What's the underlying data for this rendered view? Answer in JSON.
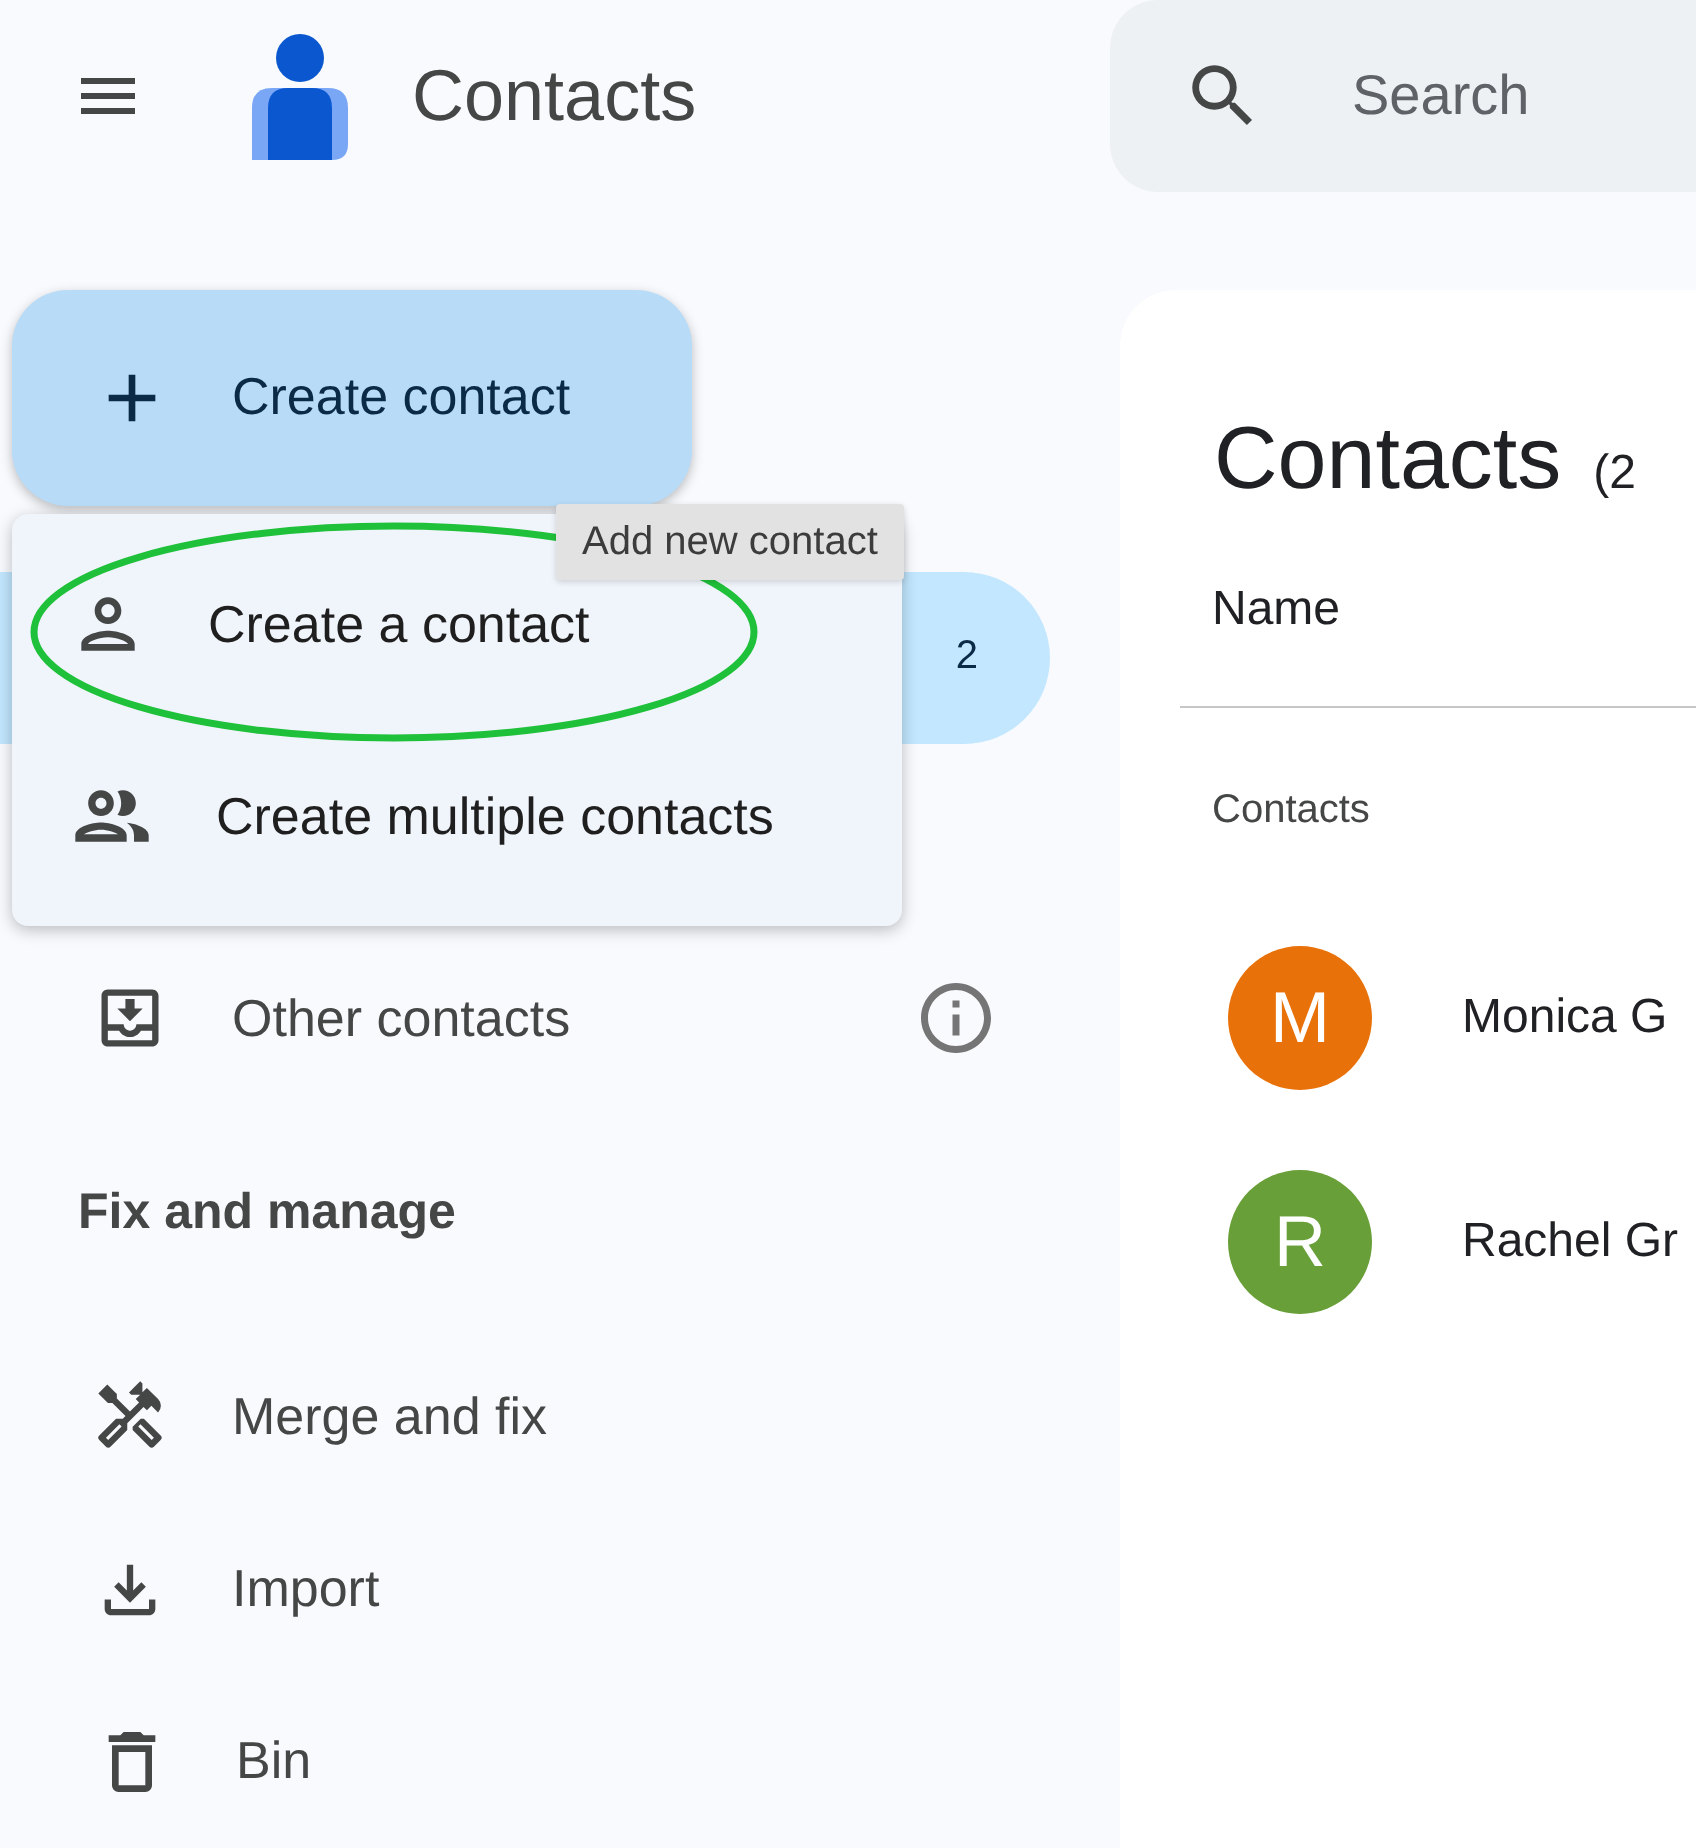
{
  "app": {
    "title": "Contacts"
  },
  "search": {
    "placeholder": "Search"
  },
  "create_button": {
    "label": "Create contact"
  },
  "nav_contacts": {
    "count": "2",
    "selected": true
  },
  "create_menu": {
    "items": [
      {
        "kind": "single",
        "label": "Create a contact",
        "circled": true
      },
      {
        "kind": "multiple",
        "label": "Create multiple contacts",
        "circled": false
      }
    ]
  },
  "tooltip": "Add new contact",
  "sidebar_items": [
    {
      "kind": "other",
      "label": "Other contacts",
      "info": true
    }
  ],
  "fix_section": {
    "title": "Fix and manage",
    "items": [
      {
        "kind": "merge",
        "label": "Merge and fix"
      },
      {
        "kind": "import",
        "label": "Import"
      },
      {
        "kind": "bin",
        "label": "Bin"
      }
    ]
  },
  "main": {
    "title": "Contacts",
    "count": "(2",
    "column": "Name",
    "section": "Contacts",
    "contacts": [
      {
        "initial": "M",
        "name": "Monica G",
        "color": "#e8710a"
      },
      {
        "initial": "R",
        "name": "Rachel Gr",
        "color": "#689f38"
      }
    ]
  }
}
